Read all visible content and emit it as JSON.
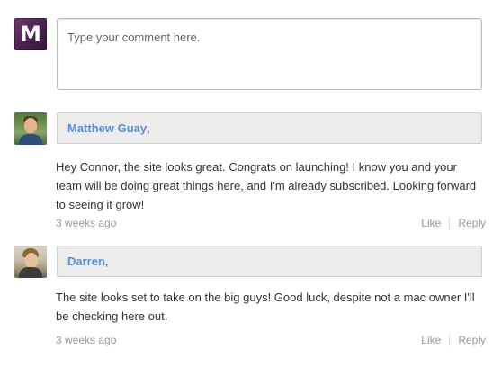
{
  "composer": {
    "avatar_letter": "M",
    "placeholder": "Type your comment here."
  },
  "comments": [
    {
      "author": "Matthew Guay",
      "separator": ",",
      "body": "Hey Connor, the site looks great. Congrats on launching! I know you and your team will be doing great things here, and I'm already subscribed. Looking forward to seeing it grow!",
      "timestamp": "3 weeks ago",
      "like_label": "Like",
      "reply_label": "Reply"
    },
    {
      "author": "Darren",
      "separator": ",",
      "body": "The site looks set to take on the big guys! Good luck, despite not a mac owner I'll be checking here out.",
      "timestamp": "3 weeks ago",
      "like_label": "Like",
      "reply_label": "Reply"
    }
  ],
  "colors": {
    "author_link": "#5a8fd6",
    "meta_text": "#999999",
    "author_bar_bg": "#ececec",
    "composer_avatar": "#4a2250"
  }
}
